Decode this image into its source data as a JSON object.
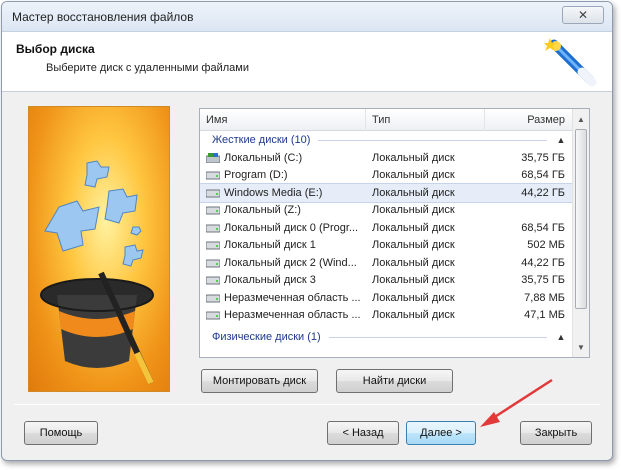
{
  "window": {
    "title": "Мастер восстановления файлов",
    "close_label": "✕"
  },
  "header": {
    "title": "Выбор диска",
    "subtitle": "Выберите диск с удаленными файлами"
  },
  "list": {
    "columns": {
      "name": "Имя",
      "type": "Тип",
      "size": "Размер"
    },
    "groups": {
      "hard": "Жесткие диски (10)",
      "physical": "Физические диски (1)"
    },
    "rows": [
      {
        "name": "Локальный (C:)",
        "type": "Локальный диск",
        "size": "35,75 ГБ",
        "icon": "system-drive-icon"
      },
      {
        "name": "Program (D:)",
        "type": "Локальный диск",
        "size": "68,54 ГБ",
        "icon": "drive-icon"
      },
      {
        "name": "Windows Media (E:)",
        "type": "Локальный диск",
        "size": "44,22 ГБ",
        "icon": "drive-icon"
      },
      {
        "name": "Локальный (Z:)",
        "type": "Локальный диск",
        "size": "",
        "icon": "drive-icon"
      },
      {
        "name": "Локальный диск 0 (Progr...",
        "type": "Локальный диск",
        "size": "68,54 ГБ",
        "icon": "drive-icon"
      },
      {
        "name": "Локальный диск 1",
        "type": "Локальный диск",
        "size": "502 МБ",
        "icon": "drive-icon"
      },
      {
        "name": "Локальный диск 2 (Wind...",
        "type": "Локальный диск",
        "size": "44,22 ГБ",
        "icon": "drive-icon"
      },
      {
        "name": "Локальный диск 3",
        "type": "Локальный диск",
        "size": "35,75 ГБ",
        "icon": "drive-icon"
      },
      {
        "name": "Неразмеченная область ...",
        "type": "Локальный диск",
        "size": "7,88 МБ",
        "icon": "drive-icon"
      },
      {
        "name": "Неразмеченная область ...",
        "type": "Локальный диск",
        "size": "47,1 МБ",
        "icon": "drive-icon"
      }
    ]
  },
  "actions": {
    "mount": "Монтировать диск",
    "find": "Найти диски"
  },
  "footer": {
    "help": "Помощь",
    "back": "< Назад",
    "next": "Далее >",
    "close": "Закрыть"
  },
  "colors": {
    "accent": "#3c7fb1",
    "group_text": "#1e3a8a",
    "annotation": "#e23a3a",
    "art_bg": "#f09418"
  }
}
